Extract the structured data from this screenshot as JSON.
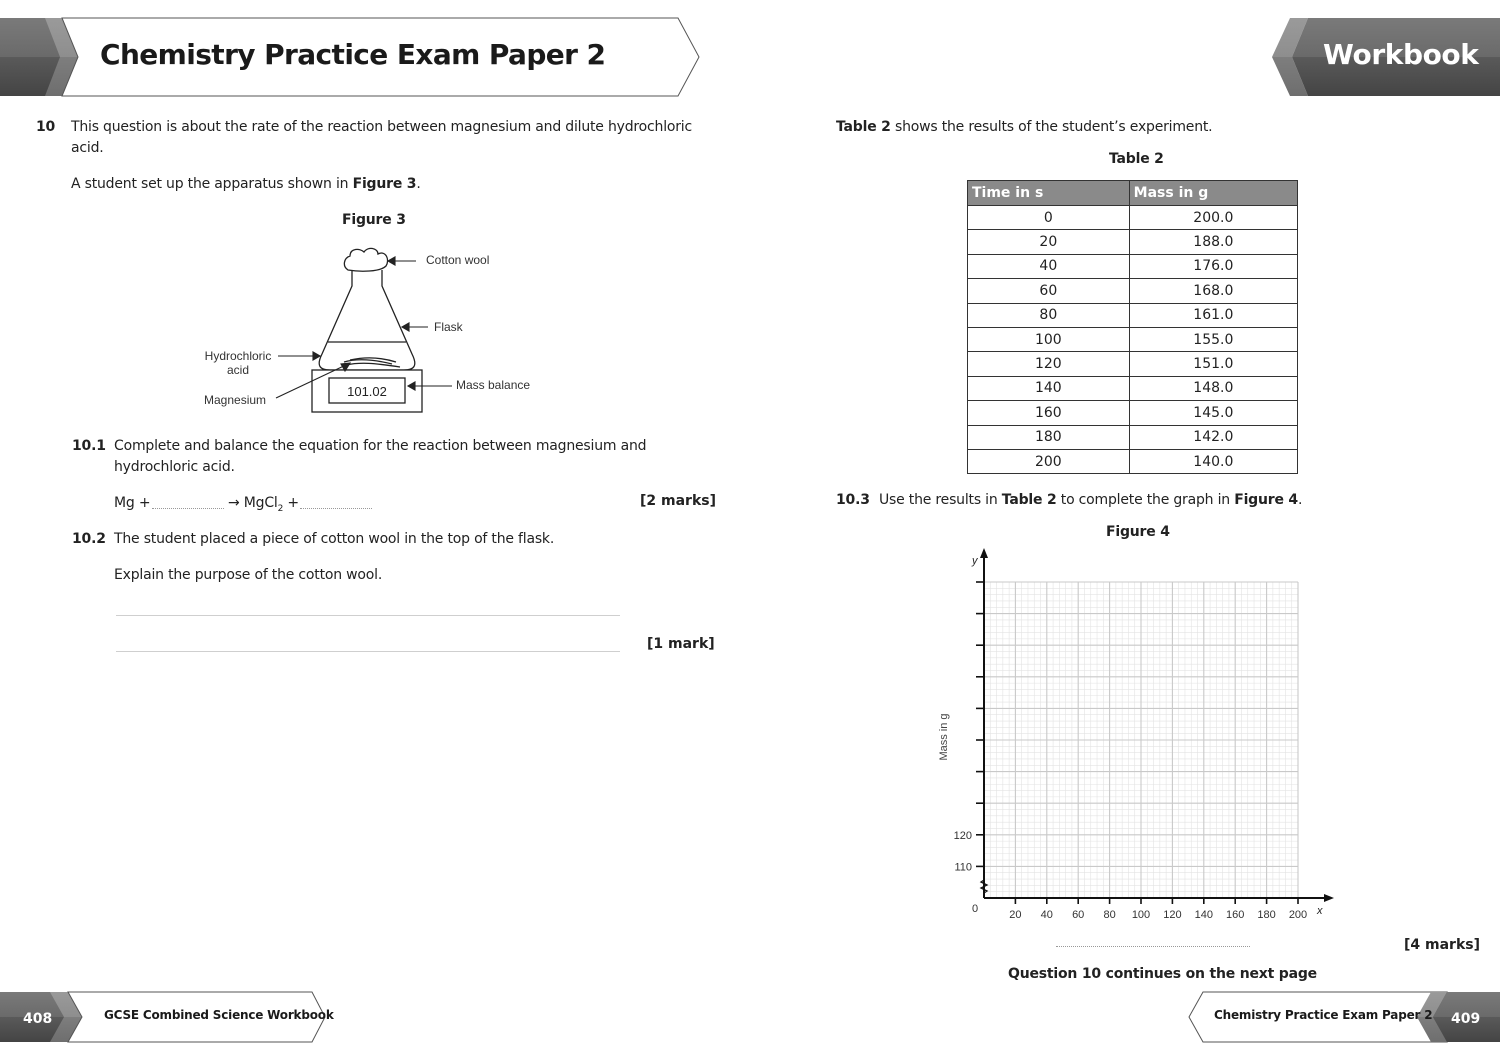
{
  "header": {
    "title": "Chemistry Practice Exam Paper 2",
    "badge": "Workbook"
  },
  "colors": {
    "banner_dark": "#5a5a5a",
    "banner_light": "#8c8c8c",
    "table_header_bg": "#8a8a8a",
    "grid_line": "#cfcfcf"
  },
  "left_page": {
    "question_number": "10",
    "intro_line1": "This question is about the rate of the reaction between magnesium and dilute hydrochloric",
    "intro_line2": "acid.",
    "setup_prefix": "A student set up the apparatus shown in ",
    "setup_ref": "Figure 3",
    "setup_suffix": ".",
    "figure3": {
      "title": "Figure 3",
      "labels": {
        "cotton_wool": "Cotton wool",
        "flask": "Flask",
        "hydrochloric_line1": "Hydrochloric",
        "hydrochloric_line2": "acid",
        "magnesium": "Magnesium",
        "mass_balance": "Mass balance",
        "display_reading": "101.02"
      }
    },
    "q10_1": {
      "number": "10.1",
      "line1": "Complete and balance the equation for the reaction between magnesium and",
      "line2": "hydrochloric acid.",
      "eq_mg": "Mg +",
      "eq_arrow": "→ MgCl",
      "eq_sub": "2",
      "eq_plus": "+",
      "marks": "[2 marks]"
    },
    "q10_2": {
      "number": "10.2",
      "line1": "The student placed a piece of cotton wool in the top of the flask.",
      "line2": "Explain the purpose of the cotton wool.",
      "marks": "[1 mark]"
    }
  },
  "right_page": {
    "table_intro_ref": "Table 2",
    "table_intro_rest": " shows the results of the student’s experiment.",
    "table2": {
      "title": "Table 2",
      "columns": [
        "Time in s",
        "Mass in g"
      ],
      "rows": [
        [
          "0",
          "200.0"
        ],
        [
          "20",
          "188.0"
        ],
        [
          "40",
          "176.0"
        ],
        [
          "60",
          "168.0"
        ],
        [
          "80",
          "161.0"
        ],
        [
          "100",
          "155.0"
        ],
        [
          "120",
          "151.0"
        ],
        [
          "140",
          "148.0"
        ],
        [
          "160",
          "145.0"
        ],
        [
          "180",
          "142.0"
        ],
        [
          "200",
          "140.0"
        ]
      ]
    },
    "q10_3": {
      "number": "10.3",
      "text_a": "Use the results in ",
      "ref1": "Table 2",
      "text_b": " to complete the graph in ",
      "ref2": "Figure 4",
      "text_c": ".",
      "marks": "[4 marks]"
    },
    "continues": "Question 10 continues on the next page"
  },
  "chart_data": {
    "type": "line",
    "title": "Figure 4",
    "xlabel": "x",
    "ylabel": "Mass in g",
    "y_axis_letter": "y",
    "x_ticks": [
      "20",
      "40",
      "60",
      "80",
      "100",
      "120",
      "140",
      "160",
      "180",
      "200"
    ],
    "y_tick_labels": [
      "110",
      "120"
    ],
    "origin_label": "0",
    "xlim": [
      0,
      200
    ],
    "ylim": [
      100,
      200
    ],
    "y_axis_break": true,
    "grid": true,
    "series": []
  },
  "footer": {
    "left_page_num": "408",
    "left_title": "GCSE Combined Science Workbook",
    "right_title": "Chemistry Practice Exam Paper 2",
    "right_page_num": "409"
  }
}
